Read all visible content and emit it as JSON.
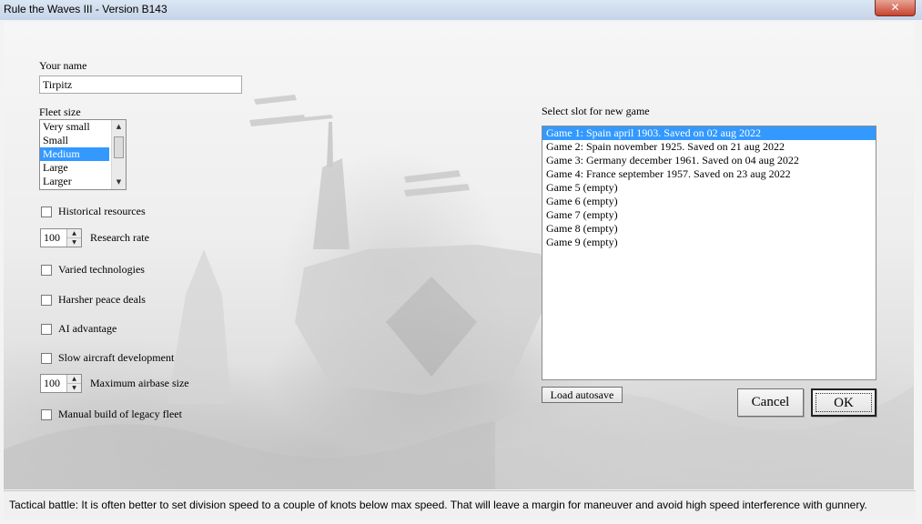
{
  "window": {
    "title": "Rule the Waves III - Version B143",
    "close_glyph": "✕"
  },
  "form": {
    "name_label": "Your name",
    "name_value": "Tirpitz",
    "fleet_label": "Fleet size",
    "fleet_options": [
      "Very small",
      "Small",
      "Medium",
      "Large",
      "Larger"
    ],
    "fleet_selected": "Medium",
    "options": [
      {
        "label": "Historical resources",
        "checked": false
      },
      {
        "label": "Varied technologies",
        "checked": false
      },
      {
        "label": "Harsher peace deals",
        "checked": false
      },
      {
        "label": "AI advantage",
        "checked": false
      },
      {
        "label": "Slow aircraft development",
        "checked": false
      },
      {
        "label": "Manual build of legacy fleet",
        "checked": false
      }
    ],
    "research_rate": {
      "value": "100",
      "label": "Research rate"
    },
    "max_airbase": {
      "value": "100",
      "label": "Maximum airbase size"
    }
  },
  "slots": {
    "label": "Select slot for new game",
    "items": [
      "Game 1: Spain april 1903. Saved on 02 aug 2022",
      "Game 2: Spain november 1925. Saved on 21 aug 2022",
      "Game 3: Germany december 1961. Saved on 04 aug 2022",
      "Game 4: France september 1957. Saved on 23 aug 2022",
      "Game 5 (empty)",
      "Game 6 (empty)",
      "Game 7 (empty)",
      "Game 8 (empty)",
      "Game 9 (empty)"
    ],
    "selected_index": 0
  },
  "buttons": {
    "load_autosave": "Load autosave",
    "cancel": "Cancel",
    "ok": "OK"
  },
  "status": {
    "tip": "Tactical battle: It is often better to set division speed to a couple of knots below max speed. That will leave a margin for maneuver and avoid high speed interference with gunnery."
  },
  "icons": {
    "spin_up": "▲",
    "spin_down": "▼",
    "scroll_up": "▲",
    "scroll_down": "▼"
  },
  "colors": {
    "selection": "#3399ff",
    "titlebar": "#c4d4e8",
    "close_button": "#c7442f"
  }
}
